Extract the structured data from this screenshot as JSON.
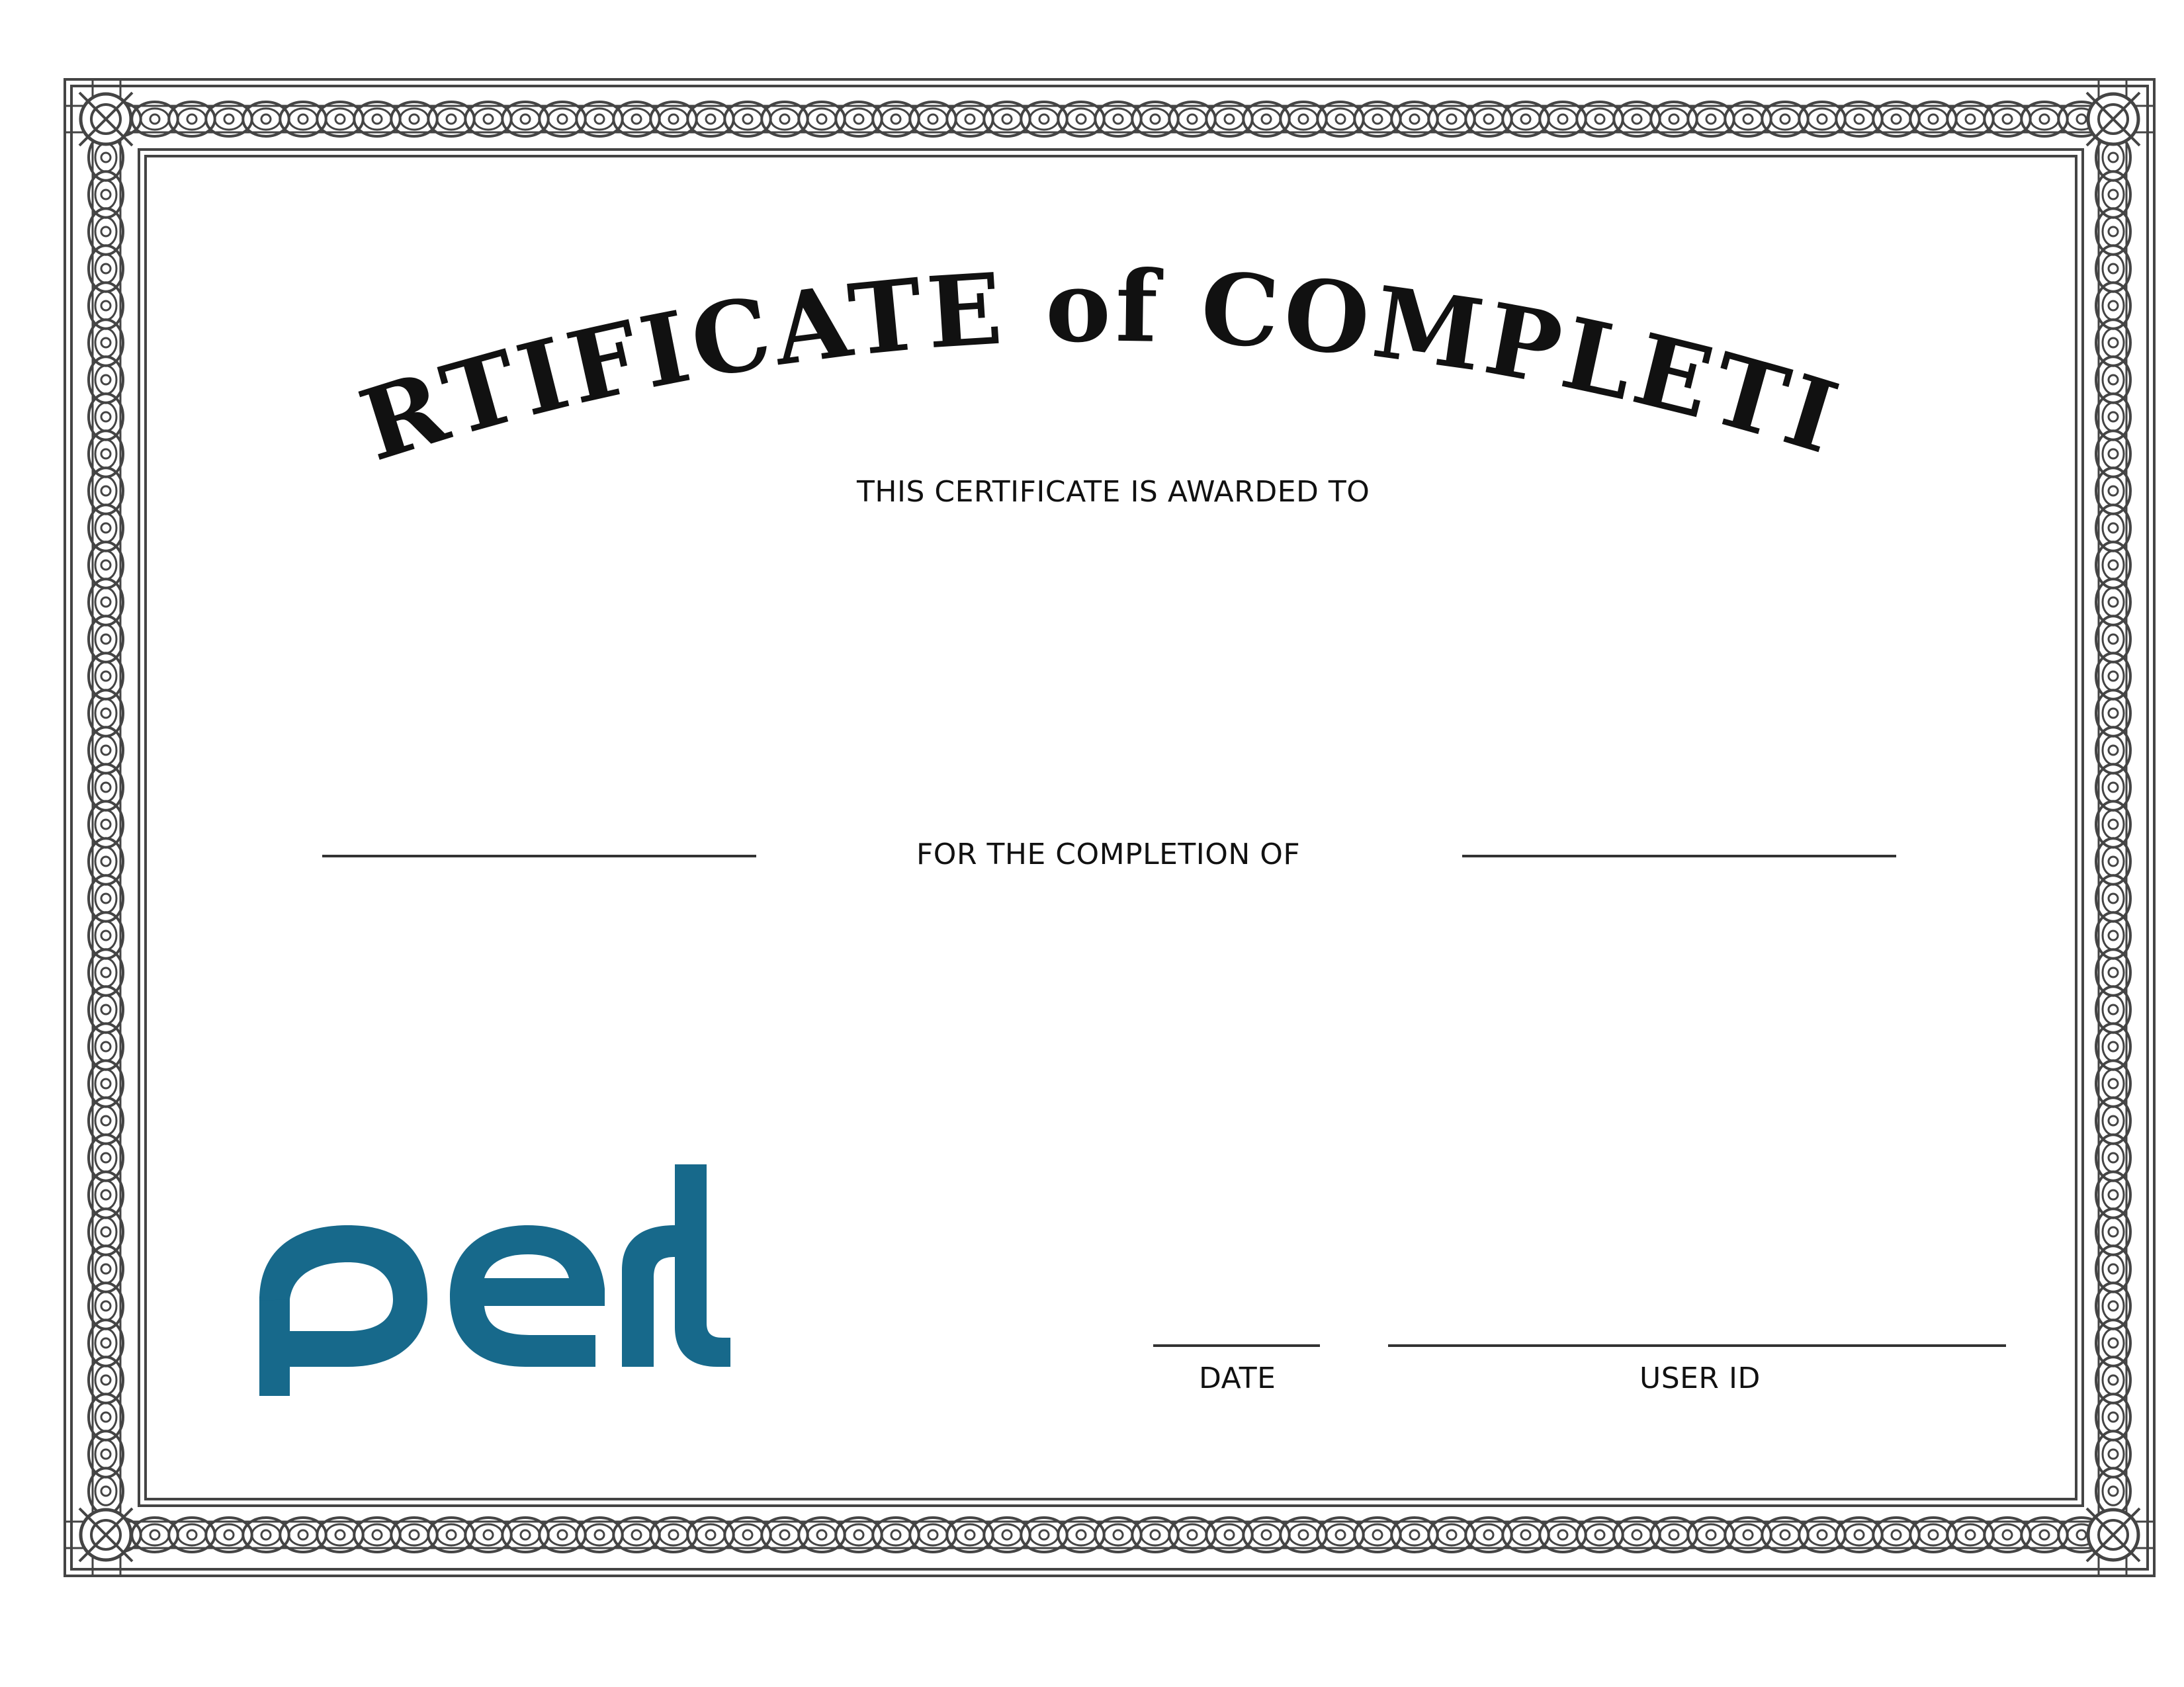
{
  "certificate": {
    "title": "CERTIFICATE of COMPLETION",
    "awarded_caption": "THIS CERTIFICATE IS AWARDED TO",
    "completion_caption": "FOR THE COMPLETION OF",
    "date_label": "DATE",
    "user_id_label": "USER ID",
    "awardee_name": "",
    "course_name": "",
    "date_value": "",
    "user_id_value": ""
  },
  "logo": {
    "text": "perls",
    "color": "#17698b"
  },
  "colors": {
    "border": "#444444",
    "title": "#111111",
    "rule": "#333333"
  }
}
